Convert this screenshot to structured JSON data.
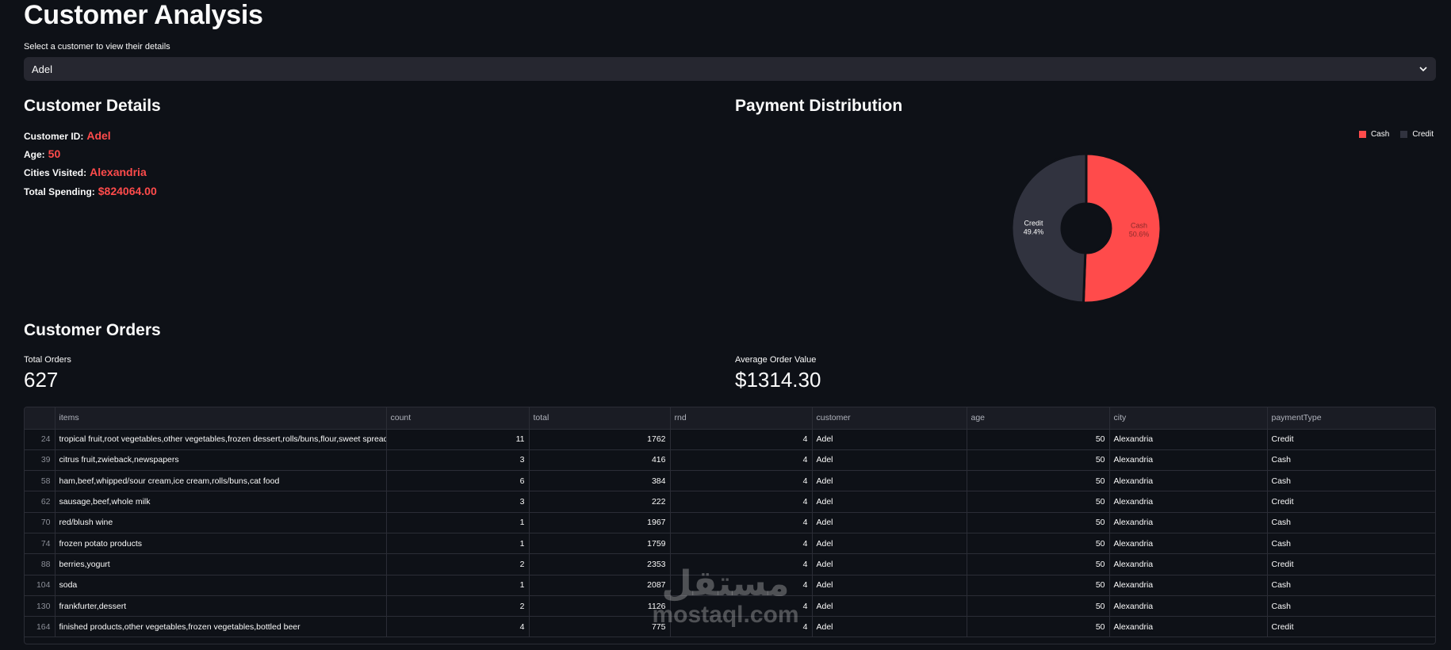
{
  "page": {
    "title": "Customer Analysis"
  },
  "selector": {
    "label": "Select a customer to view their details",
    "value": "Adel"
  },
  "details": {
    "heading": "Customer Details",
    "id_label": "Customer ID:",
    "id_value": "Adel",
    "age_label": "Age:",
    "age_value": "50",
    "cities_label": "Cities Visited:",
    "cities_value": "Alexandria",
    "spending_label": "Total Spending:",
    "spending_value": "$824064.00"
  },
  "payment": {
    "heading": "Payment Distribution",
    "legend": [
      "Cash",
      "Credit"
    ],
    "colors": {
      "cash": "#ff4b4b",
      "credit": "#31333f"
    }
  },
  "chart_data": {
    "type": "pie",
    "categories": [
      "Cash",
      "Credit"
    ],
    "values": [
      50.6,
      49.4
    ],
    "labels": [
      "Cash\n50.6%",
      "Credit\n49.4%"
    ],
    "donut": true,
    "legend": "top-right"
  },
  "orders": {
    "heading": "Customer Orders",
    "total_label": "Total Orders",
    "total_value": "627",
    "avg_label": "Average Order Value",
    "avg_value": "$1314.30",
    "columns": [
      "items",
      "count",
      "total",
      "rnd",
      "customer",
      "age",
      "city",
      "paymentType"
    ],
    "rows": [
      [
        "24",
        "tropical fruit,root vegetables,other vegetables,frozen dessert,rolls/buns,flour,sweet spreads,sa",
        "11",
        "1762",
        "4",
        "Adel",
        "50",
        "Alexandria",
        "Credit"
      ],
      [
        "39",
        "citrus fruit,zwieback,newspapers",
        "3",
        "416",
        "4",
        "Adel",
        "50",
        "Alexandria",
        "Cash"
      ],
      [
        "58",
        "ham,beef,whipped/sour cream,ice cream,rolls/buns,cat food",
        "6",
        "384",
        "4",
        "Adel",
        "50",
        "Alexandria",
        "Cash"
      ],
      [
        "62",
        "sausage,beef,whole milk",
        "3",
        "222",
        "4",
        "Adel",
        "50",
        "Alexandria",
        "Credit"
      ],
      [
        "70",
        "red/blush wine",
        "1",
        "1967",
        "4",
        "Adel",
        "50",
        "Alexandria",
        "Cash"
      ],
      [
        "74",
        "frozen potato products",
        "1",
        "1759",
        "4",
        "Adel",
        "50",
        "Alexandria",
        "Cash"
      ],
      [
        "88",
        "berries,yogurt",
        "2",
        "2353",
        "4",
        "Adel",
        "50",
        "Alexandria",
        "Credit"
      ],
      [
        "104",
        "soda",
        "1",
        "2087",
        "4",
        "Adel",
        "50",
        "Alexandria",
        "Cash"
      ],
      [
        "130",
        "frankfurter,dessert",
        "2",
        "1126",
        "4",
        "Adel",
        "50",
        "Alexandria",
        "Cash"
      ],
      [
        "164",
        "finished products,other vegetables,frozen vegetables,bottled beer",
        "4",
        "775",
        "4",
        "Adel",
        "50",
        "Alexandria",
        "Credit"
      ]
    ]
  },
  "watermark": {
    "arabic": "مستقل",
    "latin": "mostaql.com"
  }
}
